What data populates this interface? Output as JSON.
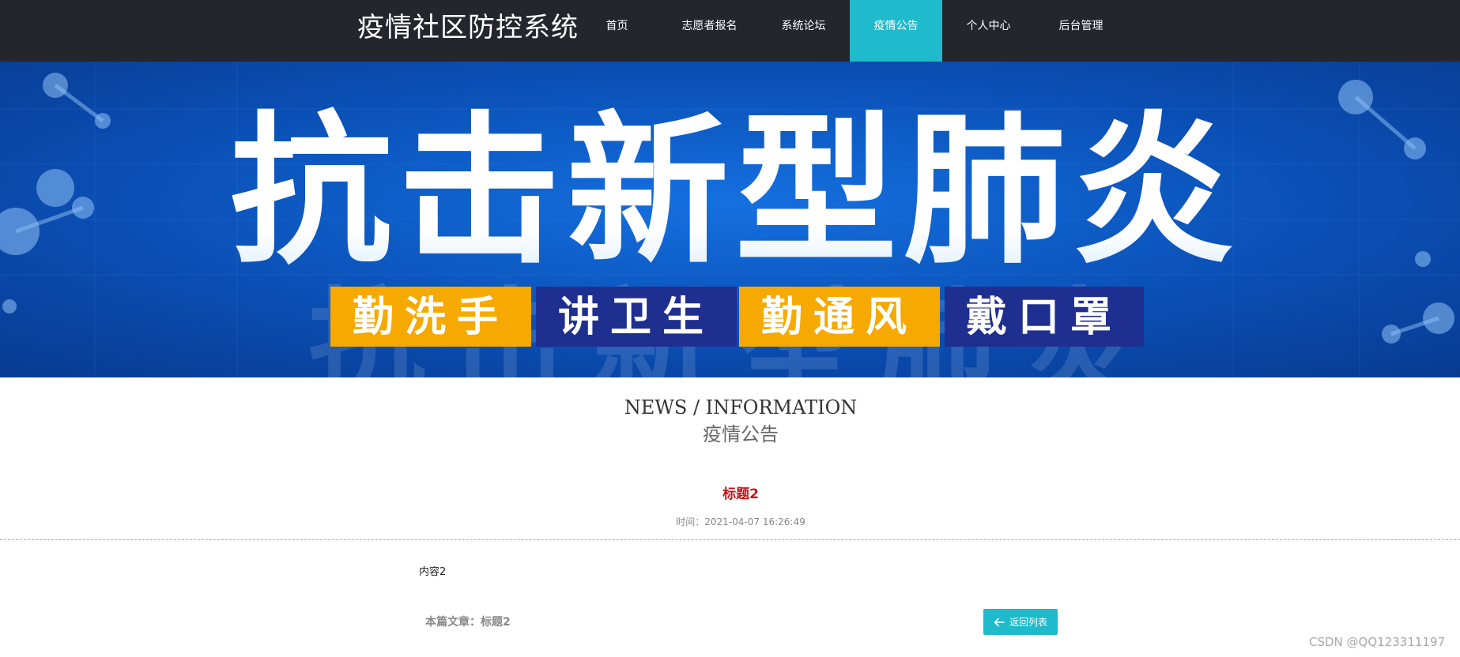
{
  "header": {
    "site_title": "疫情社区防控系统",
    "nav": [
      {
        "label": "首页",
        "active": false
      },
      {
        "label": "志愿者报名",
        "active": false
      },
      {
        "label": "系统论坛",
        "active": false
      },
      {
        "label": "疫情公告",
        "active": true
      },
      {
        "label": "个人中心",
        "active": false
      },
      {
        "label": "后台管理",
        "active": false
      }
    ]
  },
  "banner": {
    "headline": "抗击新型肺炎",
    "slogans": [
      "勤洗手",
      "讲卫生",
      "勤通风",
      "戴口罩"
    ],
    "colors": {
      "blue": "#0a4fb5",
      "yellow": "#f6a900",
      "navy": "#1f2f8f"
    }
  },
  "section": {
    "title_en": "NEWS / INFORMATION",
    "title_cn": "疫情公告"
  },
  "article": {
    "title": "标题2",
    "time_label": "时间：",
    "time_value": "2021-04-07 16:26:49",
    "content": "内容2",
    "footer_label": "本篇文章：",
    "footer_title": "标题2",
    "back_label": "返回列表"
  },
  "watermark": "CSDN @QQ123311197",
  "colors": {
    "nav_bg": "#23262d",
    "accent": "#1fbacb",
    "title_red": "#c0161a"
  }
}
